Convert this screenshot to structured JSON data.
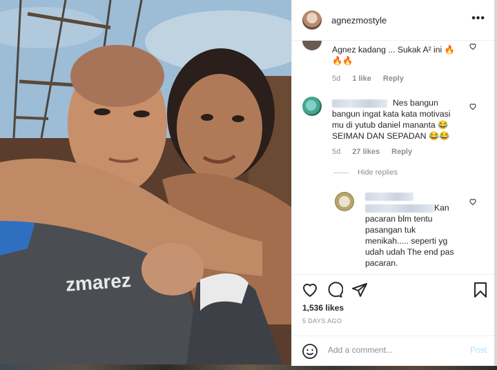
{
  "post": {
    "username": "agnezmostyle",
    "more_icon": "more-horizontal-icon",
    "likes": "1,536 likes",
    "time_ago": "5 DAYS AGO",
    "add_comment_placeholder": "Add a comment...",
    "post_label": "Post"
  },
  "comments": [
    {
      "text": "Agnez kadang ... Sukak A² ini 🔥",
      "text2": "🔥🔥",
      "age": "5d",
      "likes": "1 like",
      "reply": "Reply"
    },
    {
      "line1": "Nes bangun",
      "line2": "bangun ingat kata kata motivasi",
      "line3": "mu di yutub daniel mananta 😂",
      "line4": "SEIMAN DAN SEPADAN 😂😂",
      "age": "5d",
      "likes": "27 likes",
      "reply": "Reply"
    }
  ],
  "hide_replies": "Hide replies",
  "reply_comment": {
    "line1": "Kan",
    "line2": "pacaran blm tentu",
    "line3": "pasangan tuk",
    "line4": "menikah..... seperti yg",
    "line5": "udah udah The end pas",
    "line6": "pacaran."
  },
  "photo": {
    "shirt_text": "zmarez"
  },
  "icons": [
    "heart-icon",
    "comment-icon",
    "share-icon",
    "bookmark-icon",
    "emoji-icon"
  ]
}
